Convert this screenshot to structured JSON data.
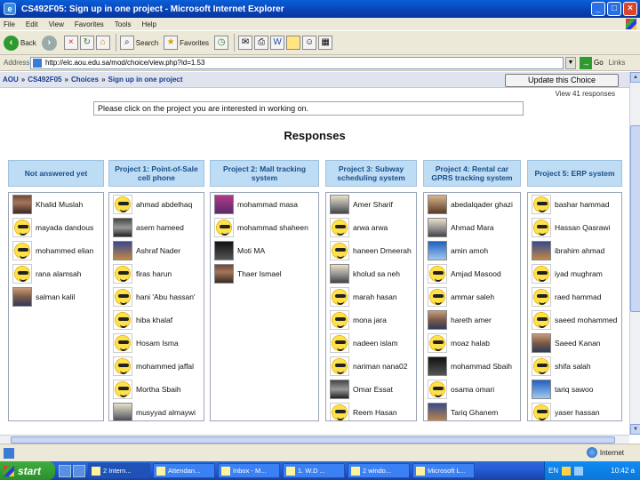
{
  "window": {
    "title": "CS492F05: Sign up in one project - Microsoft Internet Explorer"
  },
  "menu": [
    "File",
    "Edit",
    "View",
    "Favorites",
    "Tools",
    "Help"
  ],
  "toolbar": {
    "back": "Back",
    "search": "Search",
    "favorites": "Favorites"
  },
  "address": {
    "label": "Address",
    "url": "http://elc.aou.edu.sa/mod/choice/view.php?id=1.53",
    "go": "Go",
    "links": "Links"
  },
  "breadcrumb": {
    "items": [
      "AOU",
      "CS492F05",
      "Choices",
      "Sign up in one project"
    ]
  },
  "update_button": "Update this Choice",
  "view_responses": "View 41 responses",
  "instruction": "Please click on the project you are interested in working on.",
  "heading": "Responses",
  "columns": [
    {
      "header": "Not answered yet",
      "entries": [
        {
          "name": "Khalid Muslah",
          "pic": "photo-a"
        },
        {
          "name": "mayada dandous",
          "pic": "smiley"
        },
        {
          "name": "mohammed elian",
          "pic": "smiley"
        },
        {
          "name": "rana alamsah",
          "pic": "smiley"
        },
        {
          "name": "salman kalil",
          "pic": "photo-b"
        }
      ]
    },
    {
      "header": "Project 1: Point-of-Sale cell phone",
      "entries": [
        {
          "name": "ahmad abdelhaq",
          "pic": "smiley"
        },
        {
          "name": "asem hameed",
          "pic": "photo-c"
        },
        {
          "name": "Ashraf Nader",
          "pic": "photo-i"
        },
        {
          "name": "firas harun",
          "pic": "smiley"
        },
        {
          "name": "hani 'Abu hassan'",
          "pic": "smiley"
        },
        {
          "name": "hiba khalaf",
          "pic": "smiley"
        },
        {
          "name": "Hosam Isma",
          "pic": "smiley"
        },
        {
          "name": "mohammed jaffal",
          "pic": "smiley"
        },
        {
          "name": "Mortha Sbaih",
          "pic": "smiley"
        },
        {
          "name": "musyyad almaywi",
          "pic": "photo-e"
        }
      ]
    },
    {
      "header": "Project 2: Mall tracking system",
      "entries": [
        {
          "name": "mohammad masa",
          "pic": "photo-d"
        },
        {
          "name": "mohammad shaheen",
          "pic": "smiley"
        },
        {
          "name": "Moti MA",
          "pic": "photo-h"
        },
        {
          "name": "Thaer Ismael",
          "pic": "photo-a"
        }
      ]
    },
    {
      "header": "Project 3: Subway scheduling system",
      "entries": [
        {
          "name": "Amer Sharif",
          "pic": "photo-e"
        },
        {
          "name": "arwa arwa",
          "pic": "smiley"
        },
        {
          "name": "haneen Dmeerah",
          "pic": "smiley"
        },
        {
          "name": "kholud sa neh",
          "pic": "photo-e"
        },
        {
          "name": "marah hasan",
          "pic": "smiley"
        },
        {
          "name": "mona jara",
          "pic": "smiley"
        },
        {
          "name": "nadeen islam",
          "pic": "smiley"
        },
        {
          "name": "nariman nana02",
          "pic": "smiley"
        },
        {
          "name": "Omar Essat",
          "pic": "photo-c"
        },
        {
          "name": "Reem Hasan",
          "pic": "smiley"
        }
      ]
    },
    {
      "header": "Project 4: Rental car GPRS tracking system",
      "entries": [
        {
          "name": "abedalqader ghazi",
          "pic": "photo-g"
        },
        {
          "name": "Ahmad Mara",
          "pic": "photo-e"
        },
        {
          "name": "amin amoh",
          "pic": "photo-f"
        },
        {
          "name": "Amjad Masood",
          "pic": "smiley"
        },
        {
          "name": "ammar saleh",
          "pic": "smiley"
        },
        {
          "name": "hareth amer",
          "pic": "photo-b"
        },
        {
          "name": "moaz halab",
          "pic": "smiley"
        },
        {
          "name": "mohammad Sbaih",
          "pic": "photo-h"
        },
        {
          "name": "osama omari",
          "pic": "smiley"
        },
        {
          "name": "Tariq Ghanem",
          "pic": "photo-i"
        }
      ]
    },
    {
      "header": "Project 5: ERP system",
      "entries": [
        {
          "name": "bashar hammad",
          "pic": "smiley"
        },
        {
          "name": "Hassan Qasrawi",
          "pic": "smiley"
        },
        {
          "name": "ibrahim ahmad",
          "pic": "photo-i"
        },
        {
          "name": "iyad mughram",
          "pic": "smiley"
        },
        {
          "name": "raed hammad",
          "pic": "smiley"
        },
        {
          "name": "saeed mohammed",
          "pic": "smiley"
        },
        {
          "name": "Saeed Kanan",
          "pic": "photo-b"
        },
        {
          "name": "shifa salah",
          "pic": "smiley"
        },
        {
          "name": "tariq sawoo",
          "pic": "photo-f"
        },
        {
          "name": "yaser hassan",
          "pic": "smiley"
        }
      ]
    }
  ],
  "status": {
    "zone": "Internet"
  },
  "taskbar": {
    "start": "start",
    "tasks": [
      "2 Intern...",
      "Attendan...",
      "Inbox - M...",
      "1. W.D ...",
      "2 windo...",
      "Microsoft L..."
    ],
    "lang": "EN",
    "clock": "10:42 a"
  }
}
